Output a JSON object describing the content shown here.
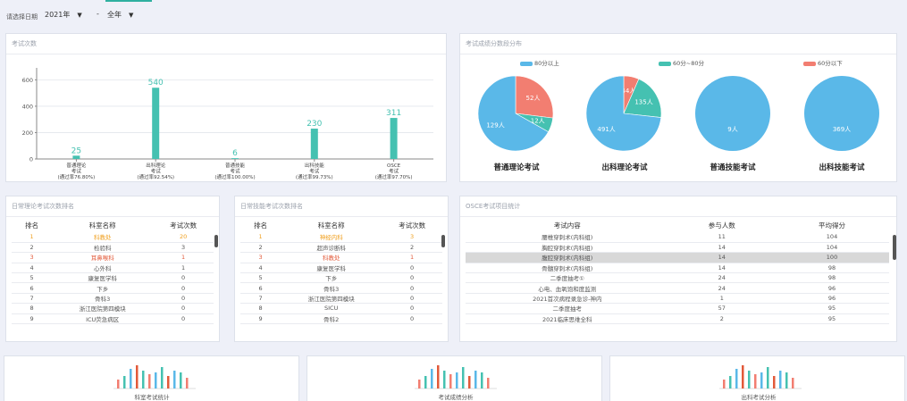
{
  "filter": {
    "label": "请选择日期",
    "year": "2021年",
    "dash": "-",
    "period": "全年"
  },
  "colors": {
    "blue": "#5ab8e8",
    "teal": "#45c1b1",
    "salmon": "#f27e71",
    "accent": "#2fb0a0"
  },
  "exam_count": {
    "title": "考试次数",
    "chart_data": {
      "type": "bar",
      "categories": [
        "普通理论考试(通过率76.80%)",
        "出科理论考试(通过率92.54%)",
        "普通技能考试(通过率100.00%)",
        "出科技能考试(通过率99.73%)",
        "OSCE考试(通过率97.70%)"
      ],
      "tick_labels": [
        [
          "普通理论",
          "考试",
          "(通过率76.80%)"
        ],
        [
          "出科理论",
          "考试",
          "(通过率92.54%)"
        ],
        [
          "普通技能",
          "考试",
          "(通过率100.00%)"
        ],
        [
          "出科技能",
          "考试",
          "(通过率99.73%)"
        ],
        [
          "OSCE",
          "考试",
          "(通过率97.70%)"
        ]
      ],
      "values": [
        25,
        540,
        6,
        230,
        311
      ],
      "yticks": [
        0,
        200,
        400,
        600
      ],
      "ylim": [
        0,
        650
      ],
      "grid": true,
      "color": "#45c1b1"
    }
  },
  "score_dist": {
    "title": "考试成绩分数段分布",
    "chart_data": {
      "type": "pie",
      "legend": [
        {
          "name": "80分以上",
          "color": "#5ab8e8"
        },
        {
          "name": "60分~80分",
          "color": "#45c1b1"
        },
        {
          "name": "60分以下",
          "color": "#f27e71"
        }
      ],
      "legend_position": "top",
      "pies": [
        {
          "name": "普通理论考试",
          "slices": [
            {
              "series": "80分以上",
              "value": 129,
              "label": "129人"
            },
            {
              "series": "60分~80分",
              "value": 12,
              "label": "12人"
            },
            {
              "series": "60分以下",
              "value": 52,
              "label": "52人"
            }
          ]
        },
        {
          "name": "出科理论考试",
          "slices": [
            {
              "series": "80分以上",
              "value": 491,
              "label": "491人"
            },
            {
              "series": "60分~80分",
              "value": 135,
              "label": "135人"
            },
            {
              "series": "60分以下",
              "value": 44,
              "label": "44人"
            }
          ]
        },
        {
          "name": "普通技能考试",
          "slices": [
            {
              "series": "80分以上",
              "value": 9,
              "label": "9人"
            }
          ]
        },
        {
          "name": "出科技能考试",
          "slices": [
            {
              "series": "80分以上",
              "value": 369,
              "label": "369人"
            }
          ]
        }
      ]
    }
  },
  "theory_rank": {
    "title": "日常理论考试次数排名",
    "headers": [
      "排名",
      "科室名称",
      "考试次数"
    ],
    "rows": [
      [
        "1",
        "科教处",
        "20"
      ],
      [
        "2",
        "检验科",
        "3"
      ],
      [
        "3",
        "耳鼻喉科",
        "1"
      ],
      [
        "4",
        "心外科",
        "1"
      ],
      [
        "5",
        "康复医学科",
        "0"
      ],
      [
        "6",
        "下乡",
        "0"
      ],
      [
        "7",
        "骨科3",
        "0"
      ],
      [
        "8",
        "浙江医院第四模块",
        "0"
      ],
      [
        "9",
        "ICU荧急病区",
        "0"
      ]
    ]
  },
  "skill_rank": {
    "title": "日常技能考试次数排名",
    "headers": [
      "排名",
      "科室名称",
      "考试次数"
    ],
    "rows": [
      [
        "1",
        "神经内科",
        "3"
      ],
      [
        "2",
        "超声诊断科",
        "2"
      ],
      [
        "3",
        "科教处",
        "1"
      ],
      [
        "4",
        "康复医学科",
        "0"
      ],
      [
        "5",
        "下乡",
        "0"
      ],
      [
        "6",
        "骨科3",
        "0"
      ],
      [
        "7",
        "浙江医院第四模块",
        "0"
      ],
      [
        "8",
        "SICU",
        "0"
      ],
      [
        "9",
        "骨科2",
        "0"
      ]
    ]
  },
  "osce": {
    "title": "OSCE考试项目统计",
    "headers": [
      "考试内容",
      "参与人数",
      "平均得分"
    ],
    "rows": [
      [
        "腰椎穿刺术(内科组)",
        "11",
        "104"
      ],
      [
        "胸腔穿刺术(内科组)",
        "14",
        "104"
      ],
      [
        "腹腔穿刺术(内科组)",
        "14",
        "100"
      ],
      [
        "骨髓穿刺术(内科组)",
        "14",
        "98"
      ],
      [
        "二季度抽考①",
        "24",
        "98"
      ],
      [
        "心电、血氧饱和度监测",
        "24",
        "96"
      ],
      [
        "2021首次病程录急诊-神内",
        "1",
        "96"
      ],
      [
        "二季度抽考",
        "57",
        "95"
      ],
      [
        "2021临床思维全科",
        "2",
        "95"
      ]
    ]
  },
  "thumbs": [
    {
      "caption": "科室考试统计"
    },
    {
      "caption": "考试成绩分析"
    },
    {
      "caption": "出科考试分析"
    }
  ]
}
